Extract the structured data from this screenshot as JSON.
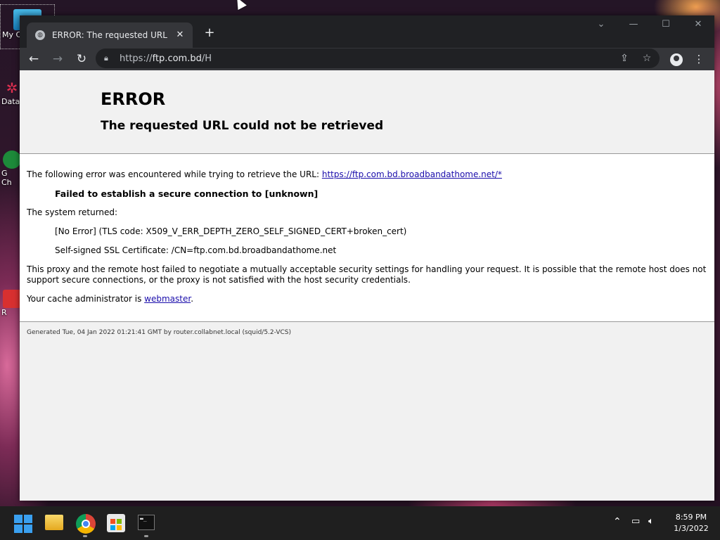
{
  "desktop": {
    "icons": [
      {
        "label": "My C",
        "top": "mycomp"
      },
      {
        "label": "Data"
      },
      {
        "label": "G\nCh"
      },
      {
        "label": "R"
      }
    ]
  },
  "browser": {
    "tab": {
      "title": "ERROR: The requested URL could"
    },
    "address": {
      "scheme": "https://",
      "host": "ftp.com.bd",
      "path": "/H"
    }
  },
  "page": {
    "heading": "ERROR",
    "subheading": "The requested URL could not be retrieved",
    "intro": "The following error was encountered while trying to retrieve the URL: ",
    "url_link": "https://ftp.com.bd.broadbandathome.net/*",
    "failure": "Failed to establish a secure connection to [unknown]",
    "system_returned": "The system returned:",
    "tls_error": "[No Error] (TLS code: X509_V_ERR_DEPTH_ZERO_SELF_SIGNED_CERT+broken_cert)",
    "cert_info": "Self-signed SSL Certificate: /CN=ftp.com.bd.broadbandathome.net",
    "explanation": "This proxy and the remote host failed to negotiate a mutually acceptable security settings for handling your request. It is possible that the remote host does not support secure connections, or the proxy is not satisfied with the host security credentials.",
    "admin_prefix": "Your cache administrator is ",
    "admin_link": "webmaster",
    "admin_suffix": ".",
    "footer": "Generated Tue, 04 Jan 2022 01:21:41 GMT by router.collabnet.local (squid/5.2-VCS)"
  },
  "taskbar": {
    "time": "8:59 PM",
    "date": "1/3/2022"
  },
  "icons": {
    "tab_favicon": "globe-icon",
    "back": "arrow-left-icon",
    "forward": "arrow-right-icon",
    "reload": "reload-icon",
    "lock": "lock-icon",
    "share": "share-icon",
    "bookmark": "star-icon",
    "profile": "profile-icon",
    "menu": "kebab-menu-icon"
  }
}
